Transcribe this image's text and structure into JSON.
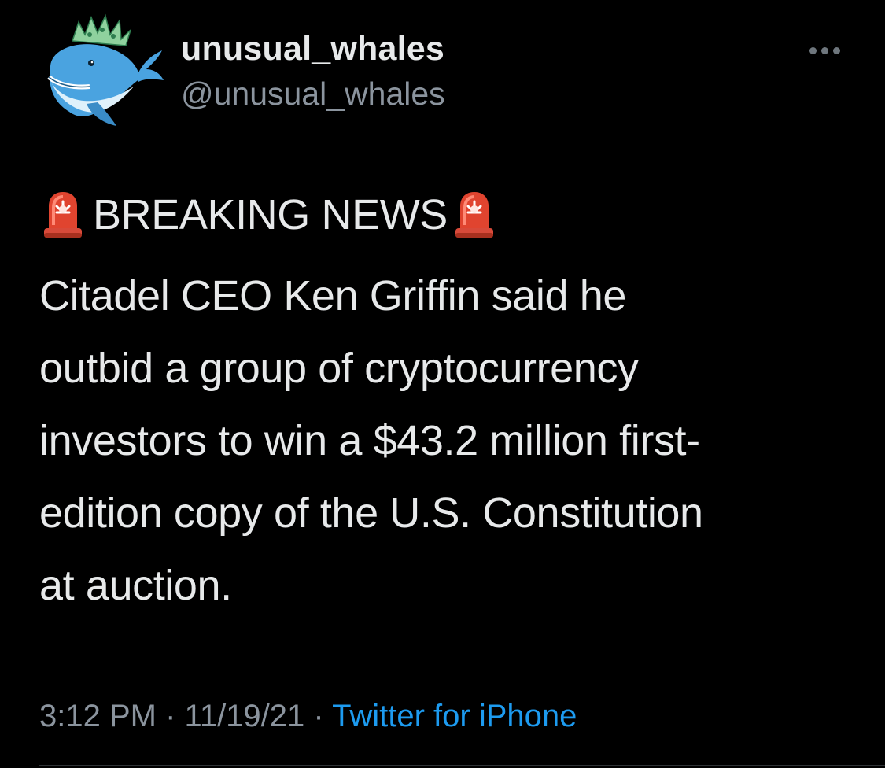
{
  "author": {
    "display_name": "unusual_whales",
    "handle": "@unusual_whales",
    "avatar_icon": "whale-icon"
  },
  "menu": {
    "icon": "more-options-icon"
  },
  "tweet": {
    "headline_icon": "rotating-light-icon",
    "headline": "BREAKING NEWS",
    "lines": [
      "Citadel CEO Ken Griffin said he",
      "outbid a group of cryptocurrency",
      "investors to win a $43.2 million first-",
      "edition copy of the U.S. Constitution",
      "at auction."
    ]
  },
  "meta": {
    "time": "3:12 PM",
    "separator": "·",
    "date": "11/19/21",
    "source": "Twitter for iPhone"
  },
  "colors": {
    "background": "#000000",
    "text": "#e7e9ea",
    "muted": "#8b949e",
    "link": "#1d9bf0"
  }
}
